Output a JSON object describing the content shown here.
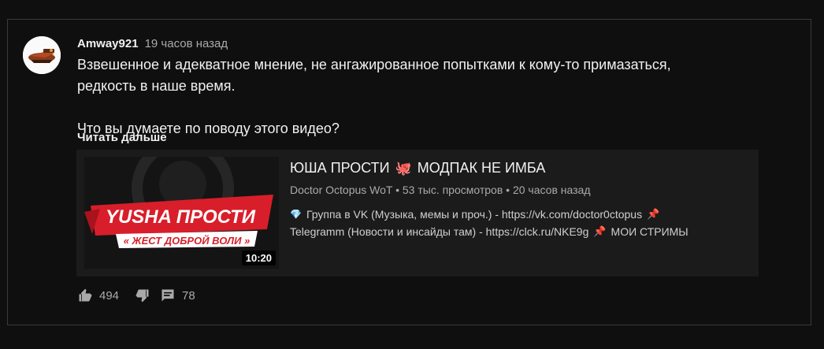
{
  "post": {
    "author": "Amway921",
    "time": "19 часов назад",
    "text_line1": "Взвешенное и адекватное мнение, не ангажированное попытками к кому-то примазаться,",
    "text_line2": "редкость в наше время.",
    "text_line3": "Что вы думаете по поводу этого видео?",
    "read_more": "Читать дальше"
  },
  "video": {
    "title_part1": "ЮША ПРОСТИ",
    "title_emoji": "🐙",
    "title_part2": "МОДПАК НЕ ИМБА",
    "meta": "Doctor Octopus WoT • 53 тыс. просмотров • 20 часов назад",
    "desc_line1_emoji": "💎",
    "desc_line1": "Группа в VK (Музыка, мемы и проч.) - https://vk.com/doctor0ctopus",
    "desc_pin": "📌",
    "desc_line2": "Telegramm (Новости и инсайды там) - https://clck.ru/NKE9g",
    "desc_line2_tail": "МОИ СТРИМЫ",
    "duration": "10:20",
    "thumb_title": "YUSHA ПРОСТИ",
    "thumb_subtitle": "« ЖЕСТ ДОБРОЙ ВОЛИ »"
  },
  "actions": {
    "likes": "494",
    "comments": "78"
  },
  "icons": {
    "like": "thumb-up-icon",
    "dislike": "thumb-down-icon",
    "comment": "comment-icon"
  },
  "colors": {
    "background": "#0f0f0f",
    "card": "#1b1b1b",
    "secondary_text": "#aaaaaa",
    "banner_red": "#d81e2a"
  }
}
